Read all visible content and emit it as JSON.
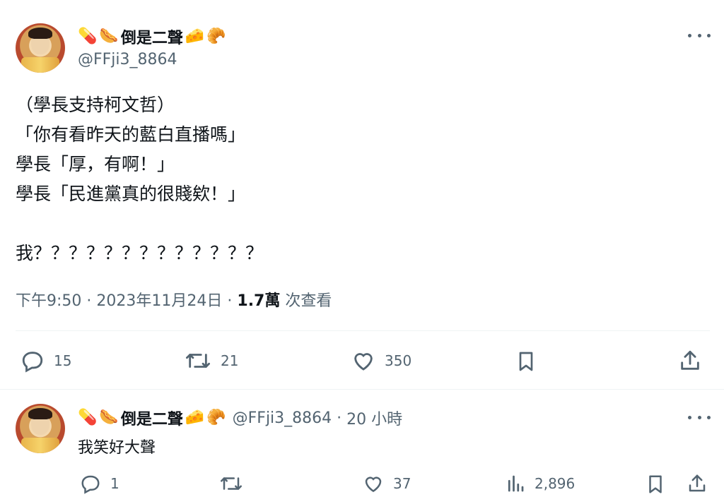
{
  "tweet": {
    "display_name": "倒是二聲",
    "emoji_prefix": [
      "💊",
      "🌭"
    ],
    "emoji_suffix": [
      "🧀",
      "🥐"
    ],
    "handle": "@FFji3_8864",
    "text": "（學長支持柯文哲）\n「你有看昨天的藍白直播嗎」\n學長「厚，有啊！」\n學長「民進黨真的很賤欸！」\n\n我？？？？？？？？？？？？？",
    "time": "下午9:50",
    "date": "2023年11月24日",
    "views_count": "1.7萬",
    "views_label": "次查看",
    "actions": {
      "replies": "15",
      "retweets": "21",
      "likes": "350"
    }
  },
  "reply": {
    "display_name": "倒是二聲",
    "emoji_prefix": [
      "💊",
      "🌭"
    ],
    "emoji_suffix": [
      "🧀",
      "🥐"
    ],
    "handle": "@FFji3_8864",
    "time_ago": "20 小時",
    "text": "我笑好大聲",
    "actions": {
      "replies": "1",
      "retweets": "",
      "likes": "37",
      "views": "2,896"
    }
  },
  "icons": {
    "more": "more-horizontal-icon",
    "reply": "reply-bubble-icon",
    "retweet": "retweet-icon",
    "like": "heart-icon",
    "views": "analytics-bars-icon",
    "bookmark": "bookmark-icon",
    "share": "share-upload-icon"
  },
  "colors": {
    "text": "#0f1419",
    "secondary": "#536471",
    "divider": "#eff3f4"
  }
}
